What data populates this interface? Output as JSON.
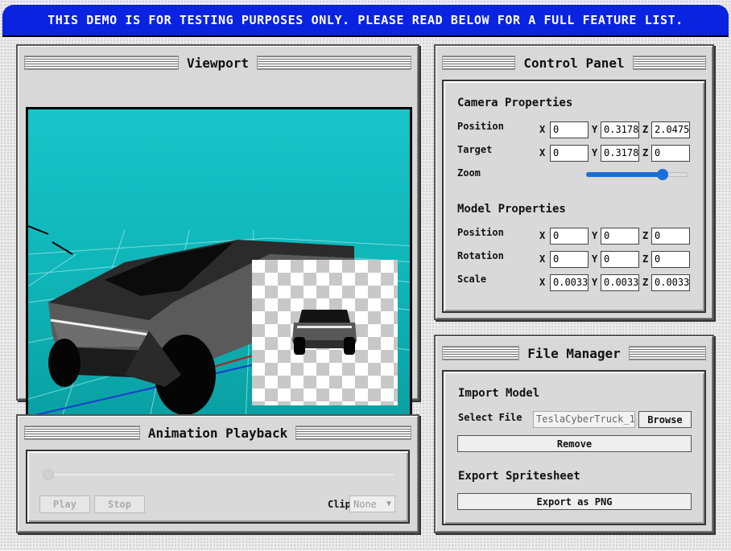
{
  "banner": "THIS DEMO IS FOR TESTING PURPOSES ONLY. PLEASE READ BELOW FOR A FULL FEATURE LIST.",
  "viewport": {
    "title": "Viewport"
  },
  "control_panel": {
    "title": "Control Panel",
    "camera": {
      "heading": "Camera Properties",
      "position_label": "Position",
      "position": {
        "x": "0",
        "y": "0.3178",
        "z": "2.0475"
      },
      "target_label": "Target",
      "target": {
        "x": "0",
        "y": "0.3178",
        "z": "0"
      },
      "zoom_label": "Zoom",
      "zoom_level": 0.75
    },
    "model": {
      "heading": "Model Properties",
      "position_label": "Position",
      "position": {
        "x": "0",
        "y": "0",
        "z": "0"
      },
      "rotation_label": "Rotation",
      "rotation": {
        "x": "0",
        "y": "0",
        "z": "0"
      },
      "scale_label": "Scale",
      "scale": {
        "x": "0.0033",
        "y": "0.0033",
        "z": "0.0033"
      }
    },
    "axis": {
      "x": "X",
      "y": "Y",
      "z": "Z"
    }
  },
  "animation": {
    "title": "Animation Playback",
    "play_label": "Play",
    "stop_label": "Stop",
    "clip_label": "Clip",
    "clip_value": "None",
    "progress": 0
  },
  "file_manager": {
    "title": "File Manager",
    "import_heading": "Import Model",
    "select_file_label": "Select File",
    "file_name": "TeslaCyberTruck_1",
    "browse_label": "Browse",
    "remove_label": "Remove",
    "export_heading": "Export Spritesheet",
    "export_label": "Export as PNG"
  }
}
